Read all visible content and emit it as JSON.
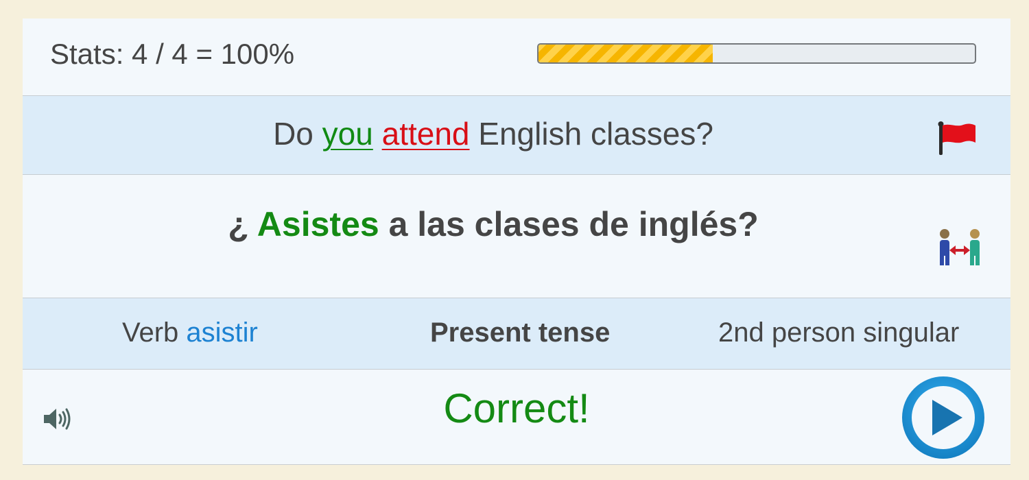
{
  "stats": {
    "text": "Stats: 4 / 4 = 100%",
    "progress_fraction": 0.4
  },
  "prompt": {
    "before": "Do ",
    "word_you": "you",
    "space": " ",
    "word_attend": "attend",
    "after": " English classes?",
    "flag_icon": "red-flag-icon"
  },
  "answer": {
    "prefix": "¿ ",
    "verb": "Asistes",
    "rest": " a las clases de inglés?",
    "icon": "person-swap-icon"
  },
  "info": {
    "verb_label": "Verb ",
    "verb_name": "asistir",
    "tense": "Present tense",
    "person": "2nd person singular"
  },
  "result": {
    "text": "Correct!",
    "speaker_icon": "speaker-icon",
    "play_icon": "play-button-icon"
  },
  "colors": {
    "background": "#f6f0dc",
    "card": "#f3f8fc",
    "band": "#dcecf9",
    "correct_green": "#148a14",
    "error_red": "#d80e16",
    "link_blue": "#1d82d2",
    "play_blue": "#1a8fd0",
    "progress_yellow": "#f6b500"
  }
}
